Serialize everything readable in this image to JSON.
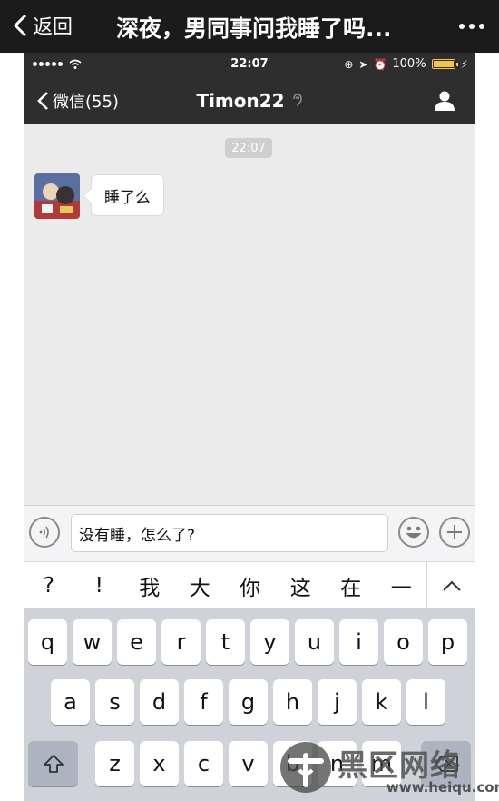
{
  "article": {
    "back_label": "返回",
    "title": "深夜，男同事问我睡了吗..."
  },
  "status_bar": {
    "time": "22:07",
    "battery": "100%"
  },
  "nav": {
    "back_label": "微信(55)",
    "title": "Timon22"
  },
  "chat": {
    "timestamp": "22:07",
    "messages": [
      {
        "sender": "Timon22",
        "text": "睡了么"
      }
    ]
  },
  "input": {
    "value": "没有睡，怎么了?"
  },
  "candidates": [
    "?",
    "!",
    "我",
    "大",
    "你",
    "这",
    "在",
    "一"
  ],
  "keyboard": {
    "row1": [
      "q",
      "w",
      "e",
      "r",
      "t",
      "y",
      "u",
      "i",
      "o",
      "p"
    ],
    "row2": [
      "a",
      "s",
      "d",
      "f",
      "g",
      "h",
      "j",
      "k",
      "l"
    ],
    "row3": [
      "z",
      "x",
      "c",
      "v",
      "b",
      "n",
      "m"
    ]
  },
  "watermark": {
    "text": "黑区网络",
    "url": "www.heiqu.com"
  },
  "colors": {
    "header_bg": "#1b1b1b",
    "nav_bg": "#2e2e2e",
    "chat_bg": "#ebebeb",
    "battery": "#f6c343",
    "keyboard_bg": "#cfd3d9"
  }
}
